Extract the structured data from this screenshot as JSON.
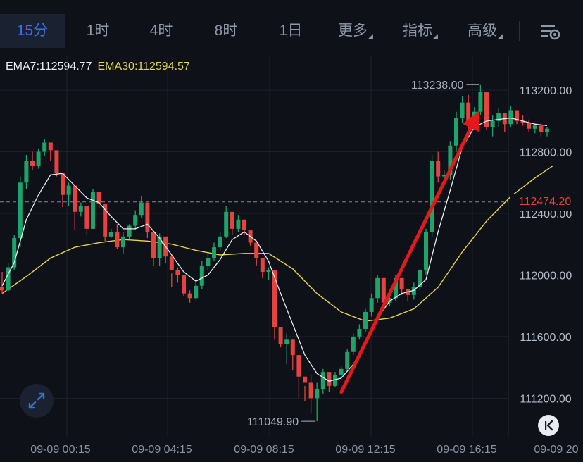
{
  "tabs": [
    {
      "label": "15分",
      "active": true
    },
    {
      "label": "1时"
    },
    {
      "label": "4时"
    },
    {
      "label": "8时"
    },
    {
      "label": "1日"
    },
    {
      "label": "更多",
      "dropdown": true
    },
    {
      "label": "指标",
      "dropdown": true
    },
    {
      "label": "高级",
      "dropdown": true
    }
  ],
  "settings_icon": "chart-settings-icon",
  "ema": {
    "ema7": "EMA7:112594.77",
    "ema30": "EMA30:112594.57"
  },
  "colors": {
    "up": "#1fa36a",
    "down": "#e5433f",
    "ema7": "#e9edf5",
    "ema30": "#e5d44d",
    "accent": "#3b73e0",
    "arrow": "#e11b1b"
  },
  "price_tag": "112474.20",
  "chart_data": {
    "type": "candlestick",
    "y_ticks": [
      "113200.00",
      "112800.00",
      "112400.00",
      "112000.00",
      "111600.00",
      "111200.00"
    ],
    "x_ticks": [
      "09-09 00:15",
      "09-09 04:15",
      "09-09 08:15",
      "09-09 12:15",
      "09-09 16:15",
      "09-09 20"
    ],
    "high_label": "113238.00",
    "low_label": "111049.90",
    "current_price": 112474.2,
    "ylim": [
      110950,
      113420
    ],
    "ohlc": [
      [
        111920,
        112020,
        111880,
        111900
      ],
      [
        111900,
        112080,
        111890,
        112050
      ],
      [
        112050,
        112260,
        112030,
        112240
      ],
      [
        112240,
        112640,
        112180,
        112600
      ],
      [
        112600,
        112780,
        112560,
        112740
      ],
      [
        112740,
        112800,
        112680,
        112710
      ],
      [
        112710,
        112820,
        112690,
        112800
      ],
      [
        112800,
        112880,
        112770,
        112860
      ],
      [
        112860,
        112830,
        112740,
        112810
      ],
      [
        112810,
        112770,
        112640,
        112660
      ],
      [
        112660,
        112600,
        112440,
        112520
      ],
      [
        112520,
        112600,
        112450,
        112580
      ],
      [
        112580,
        112440,
        112290,
        112410
      ],
      [
        112410,
        112470,
        112380,
        112450
      ],
      [
        112450,
        112360,
        112260,
        112300
      ],
      [
        112300,
        112560,
        112300,
        112540
      ],
      [
        112540,
        112520,
        112430,
        112460
      ],
      [
        112460,
        112360,
        112220,
        112250
      ],
      [
        112250,
        112300,
        112240,
        112280
      ],
      [
        112280,
        112330,
        112170,
        112180
      ],
      [
        112180,
        112280,
        112140,
        112250
      ],
      [
        112250,
        112330,
        112230,
        112320
      ],
      [
        112320,
        112420,
        112290,
        112390
      ],
      [
        112390,
        112510,
        112370,
        112470
      ],
      [
        112470,
        112360,
        112240,
        112280
      ],
      [
        112280,
        112150,
        112060,
        112110
      ],
      [
        112110,
        112270,
        112060,
        112250
      ],
      [
        112250,
        112140,
        112080,
        112120
      ],
      [
        112120,
        112010,
        111920,
        112030
      ],
      [
        112030,
        112050,
        111950,
        112000
      ],
      [
        112000,
        111920,
        111860,
        111880
      ],
      [
        111880,
        111900,
        111820,
        111850
      ],
      [
        111850,
        111960,
        111840,
        111930
      ],
      [
        111930,
        112090,
        111910,
        112060
      ],
      [
        112060,
        112140,
        112030,
        112110
      ],
      [
        112110,
        112210,
        112090,
        112180
      ],
      [
        112180,
        112280,
        112160,
        112250
      ],
      [
        112250,
        112450,
        112240,
        112410
      ],
      [
        112410,
        112380,
        112260,
        112300
      ],
      [
        112300,
        112390,
        112280,
        112360
      ],
      [
        112360,
        112340,
        112260,
        112290
      ],
      [
        112290,
        112280,
        112190,
        112210
      ],
      [
        112210,
        112160,
        112060,
        112110
      ],
      [
        112110,
        112060,
        111980,
        112020
      ],
      [
        112020,
        112050,
        111970,
        112030
      ],
      [
        112030,
        111930,
        111580,
        111660
      ],
      [
        111660,
        111600,
        111530,
        111550
      ],
      [
        111550,
        111620,
        111420,
        111580
      ],
      [
        111580,
        111520,
        111380,
        111480
      ],
      [
        111480,
        111420,
        111200,
        111340
      ],
      [
        111340,
        111280,
        111180,
        111300
      ],
      [
        111300,
        111350,
        111100,
        111200
      ],
      [
        111200,
        111300,
        111050,
        111260
      ],
      [
        111260,
        111390,
        111230,
        111370
      ],
      [
        111370,
        111330,
        111240,
        111280
      ],
      [
        111280,
        111370,
        111270,
        111350
      ],
      [
        111350,
        111410,
        111320,
        111390
      ],
      [
        111390,
        111520,
        111370,
        111500
      ],
      [
        111500,
        111620,
        111480,
        111600
      ],
      [
        111600,
        111680,
        111580,
        111650
      ],
      [
        111650,
        111780,
        111630,
        111760
      ],
      [
        111760,
        111880,
        111730,
        111850
      ],
      [
        111850,
        112000,
        111820,
        111980
      ],
      [
        111980,
        111910,
        111790,
        111820
      ],
      [
        111820,
        111870,
        111800,
        111850
      ],
      [
        111850,
        112000,
        111830,
        111980
      ],
      [
        111980,
        111960,
        111870,
        111910
      ],
      [
        111910,
        111880,
        111830,
        111870
      ],
      [
        111870,
        111950,
        111840,
        111920
      ],
      [
        111920,
        112040,
        111900,
        112030
      ],
      [
        112030,
        112300,
        112000,
        112280
      ],
      [
        112280,
        112780,
        112250,
        112740
      ],
      [
        112740,
        112800,
        112600,
        112640
      ],
      [
        112640,
        112680,
        112590,
        112650
      ],
      [
        112650,
        112870,
        112620,
        112840
      ],
      [
        112840,
        113060,
        112800,
        113020
      ],
      [
        113020,
        113160,
        112990,
        113120
      ],
      [
        113120,
        113170,
        112940,
        113000
      ],
      [
        113000,
        113090,
        112950,
        113060
      ],
      [
        113060,
        113238,
        113040,
        113190
      ],
      [
        113190,
        113180,
        112940,
        112960
      ],
      [
        112960,
        113040,
        112900,
        113000
      ],
      [
        113000,
        113080,
        112960,
        113050
      ],
      [
        113050,
        113030,
        112930,
        112980
      ],
      [
        112980,
        113100,
        112960,
        113070
      ],
      [
        113070,
        113020,
        112980,
        113000
      ],
      [
        113000,
        113040,
        112970,
        112990
      ],
      [
        112990,
        113010,
        112930,
        112950
      ],
      [
        112950,
        112980,
        112920,
        112970
      ],
      [
        112970,
        112980,
        112900,
        112930
      ],
      [
        112930,
        112960,
        112900,
        112950
      ]
    ],
    "ema7": [
      [
        0,
        111930
      ],
      [
        2,
        112080
      ],
      [
        4,
        112360
      ],
      [
        6,
        112520
      ],
      [
        8,
        112650
      ],
      [
        10,
        112660
      ],
      [
        12,
        112580
      ],
      [
        14,
        112500
      ],
      [
        16,
        112470
      ],
      [
        18,
        112380
      ],
      [
        20,
        112300
      ],
      [
        22,
        112300
      ],
      [
        24,
        112330
      ],
      [
        26,
        112240
      ],
      [
        28,
        112130
      ],
      [
        30,
        112020
      ],
      [
        32,
        111960
      ],
      [
        34,
        112000
      ],
      [
        36,
        112100
      ],
      [
        38,
        112230
      ],
      [
        40,
        112280
      ],
      [
        42,
        112220
      ],
      [
        44,
        112090
      ],
      [
        46,
        111880
      ],
      [
        48,
        111680
      ],
      [
        50,
        111480
      ],
      [
        52,
        111360
      ],
      [
        54,
        111310
      ],
      [
        56,
        111330
      ],
      [
        58,
        111420
      ],
      [
        60,
        111560
      ],
      [
        62,
        111720
      ],
      [
        64,
        111830
      ],
      [
        66,
        111880
      ],
      [
        68,
        111900
      ],
      [
        70,
        111970
      ],
      [
        72,
        112280
      ],
      [
        74,
        112550
      ],
      [
        76,
        112830
      ],
      [
        78,
        112960
      ],
      [
        80,
        113000
      ],
      [
        82,
        113010
      ],
      [
        84,
        113020
      ],
      [
        86,
        113000
      ],
      [
        88,
        112980
      ],
      [
        90,
        112970
      ]
    ],
    "ema30": [
      [
        0,
        111880
      ],
      [
        4,
        111990
      ],
      [
        8,
        112110
      ],
      [
        12,
        112180
      ],
      [
        16,
        112210
      ],
      [
        20,
        112230
      ],
      [
        24,
        112220
      ],
      [
        28,
        112200
      ],
      [
        32,
        112160
      ],
      [
        36,
        112130
      ],
      [
        40,
        112140
      ],
      [
        44,
        112140
      ],
      [
        48,
        112040
      ],
      [
        52,
        111880
      ],
      [
        56,
        111760
      ],
      [
        60,
        111700
      ],
      [
        64,
        111720
      ],
      [
        68,
        111780
      ],
      [
        72,
        111920
      ],
      [
        76,
        112150
      ],
      [
        80,
        112350
      ],
      [
        84,
        112510
      ],
      [
        88,
        112630
      ],
      [
        91,
        112710
      ]
    ],
    "arrow": {
      "from": [
        53,
        111240
      ],
      "to": [
        80,
        113070
      ]
    }
  }
}
